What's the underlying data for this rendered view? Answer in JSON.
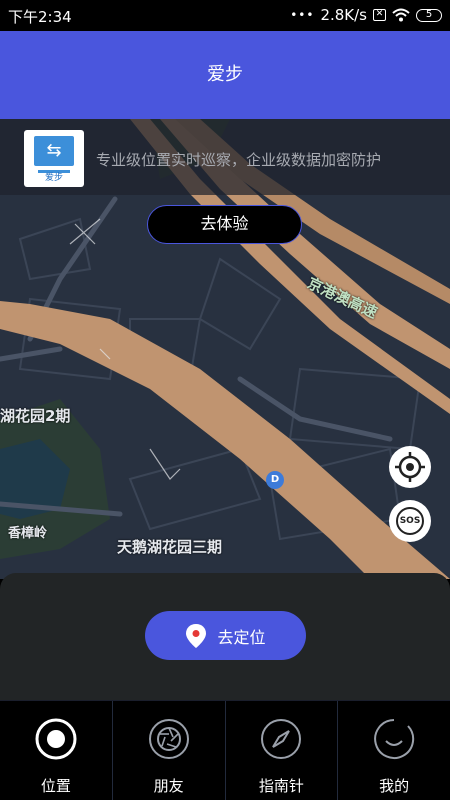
{
  "status_bar": {
    "time": "下午2:34",
    "network_speed": "2.8K/s",
    "battery": "5"
  },
  "header": {
    "title": "爱步"
  },
  "banner": {
    "logo_text": "爱步",
    "text": "专业级位置实时巡察，企业级数据加密防护"
  },
  "map": {
    "try_button": "去体验",
    "labels": {
      "expressway": "京港澳高速",
      "garden_phase2": "湖花园2期",
      "garden_phase3": "天鹅湖花园三期",
      "xiangzhangling": "香樟岭",
      "marker_d": "D"
    },
    "sos_label": "SOS"
  },
  "bottom_panel": {
    "locate_button": "去定位"
  },
  "tabs": [
    {
      "label": "位置",
      "icon": "target-icon",
      "active": true
    },
    {
      "label": "朋友",
      "icon": "aperture-icon",
      "active": false
    },
    {
      "label": "指南针",
      "icon": "compass-icon",
      "active": false
    },
    {
      "label": "我的",
      "icon": "profile-ring-icon",
      "active": false
    }
  ],
  "colors": {
    "accent": "#4a56dd",
    "map_bg": "#283140",
    "road": "#c09470"
  }
}
